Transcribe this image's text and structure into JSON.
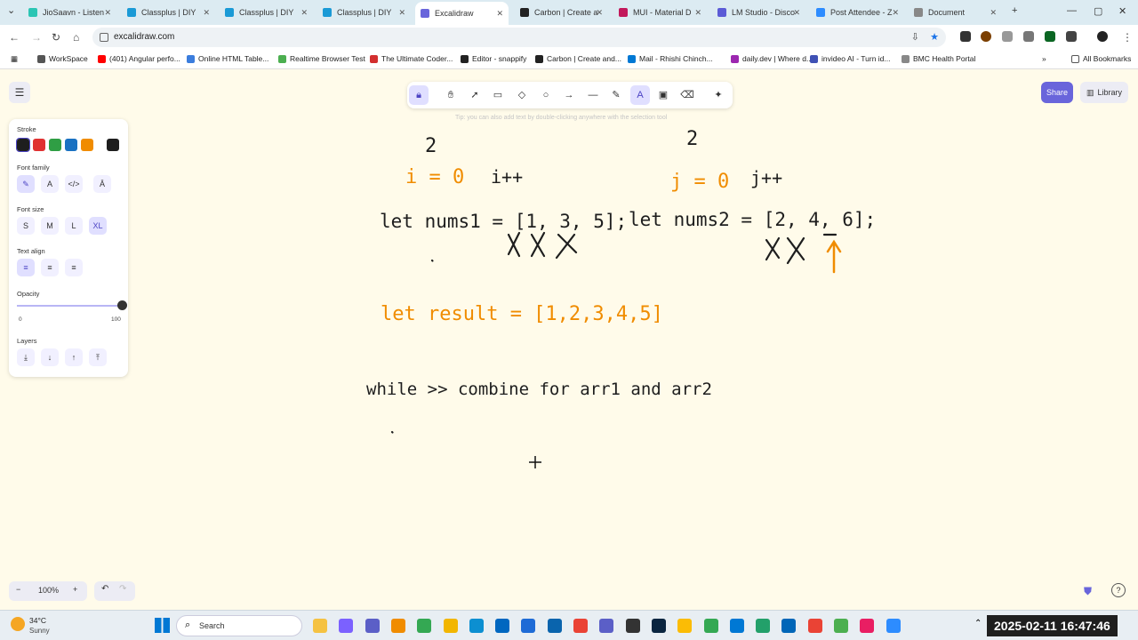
{
  "browser": {
    "tabs": [
      {
        "label": "JioSaavn - Listen",
        "color": "#2bc5b4"
      },
      {
        "label": "Classplus | DIY",
        "color": "#1a9ad6"
      },
      {
        "label": "Classplus | DIY",
        "color": "#1a9ad6"
      },
      {
        "label": "Classplus | DIY",
        "color": "#1a9ad6"
      },
      {
        "label": "Excalidraw",
        "color": "#6965db"
      },
      {
        "label": "Carbon | Create a",
        "color": "#222222"
      },
      {
        "label": "MUI - Material D",
        "color": "#c2185b"
      },
      {
        "label": "LM Studio - Disco",
        "color": "#5b5bd6"
      },
      {
        "label": "Post Attendee - Z",
        "color": "#2d8cff"
      },
      {
        "label": "Document",
        "color": "#888888"
      }
    ],
    "active_tab_index": 4,
    "url": "excalidraw.com",
    "bookmarks": [
      {
        "label": "WorkSpace",
        "color": "#555555"
      },
      {
        "label": "(401) Angular perfo...",
        "color": "#ff0000"
      },
      {
        "label": "Online HTML Table...",
        "color": "#3b7ddd"
      },
      {
        "label": "Realtime Browser Test",
        "color": "#4caf50"
      },
      {
        "label": "The Ultimate Coder...",
        "color": "#d32f2f"
      },
      {
        "label": "Editor - snappify",
        "color": "#222222"
      },
      {
        "label": "Carbon | Create and...",
        "color": "#222222"
      },
      {
        "label": "Mail - Rhishi Chinch...",
        "color": "#0078d4"
      },
      {
        "label": "daily.dev | Where d...",
        "color": "#9c27b0"
      },
      {
        "label": "invideo AI - Turn id...",
        "color": "#3f51b5"
      },
      {
        "label": "BMC Health Portal",
        "color": "#888888"
      }
    ],
    "all_bookmarks": "All Bookmarks"
  },
  "toolbar": {
    "tip": "Tip: you can also add text by double-clicking anywhere with the selection tool",
    "share_label": "Share",
    "library_label": "Library",
    "tools": [
      "lock-icon",
      "hand-icon",
      "selection-icon",
      "rectangle-icon",
      "diamond-icon",
      "ellipse-icon",
      "arrow-icon",
      "line-icon",
      "pencil-icon",
      "text-icon",
      "image-icon",
      "eraser-icon",
      "ai-icon"
    ]
  },
  "panel": {
    "stroke_label": "Stroke",
    "stroke_colors": [
      "#1e1e1e",
      "#e03131",
      "#2f9e44",
      "#1971c2",
      "#f08c00"
    ],
    "current_color": "#1e1e1e",
    "font_family_label": "Font family",
    "font_size_label": "Font size",
    "font_sizes": [
      "S",
      "M",
      "L",
      "XL"
    ],
    "selected_font_size": "XL",
    "text_align_label": "Text align",
    "opacity_label": "Opacity",
    "opacity_min": "0",
    "opacity_max": "100",
    "opacity_value": 1.0,
    "layers_label": "Layers"
  },
  "drawing": {
    "colors": {
      "ink": "#1e1e1e",
      "orange": "#f08c00"
    },
    "count_i": "2",
    "count_j": "2",
    "i_init": "i = 0",
    "i_inc": "i++",
    "j_init": "j = 0",
    "j_inc": "j++",
    "nums1": "let nums1 = [1, 3, 5];",
    "nums2": "let nums2 = [2, 4, 6];",
    "result": "let result = [1,2,3,4,5]",
    "while_text": "while >> combine for arr1 and arr2"
  },
  "footer": {
    "zoom": "100%"
  },
  "taskbar": {
    "weather_temp": "34°C",
    "weather_desc": "Sunny",
    "search_label": "Search",
    "datetime": "2025-02-11  16:47:46"
  }
}
